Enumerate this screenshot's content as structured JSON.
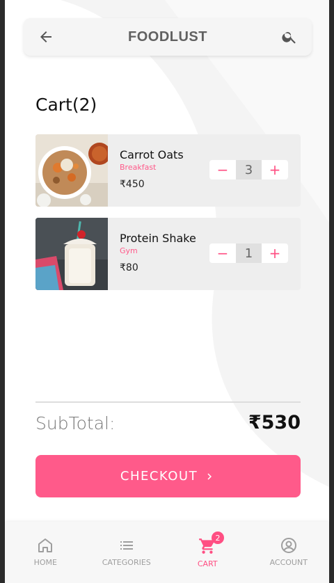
{
  "app": {
    "title": "FOODLUST",
    "accent_color": "#ff5a8a",
    "back_icon": "arrow-left-icon",
    "search_icon": "search-icon"
  },
  "cart": {
    "heading": "Cart(2)",
    "items": [
      {
        "name": "Carrot Oats",
        "category": "Breakfast",
        "price": "₹450",
        "quantity": "3",
        "image": "carrot-oats-photo"
      },
      {
        "name": "Protein Shake",
        "category": "Gym",
        "price": "₹80",
        "quantity": "1",
        "image": "protein-shake-photo"
      }
    ],
    "decrement_symbol": "−",
    "increment_symbol": "+"
  },
  "summary": {
    "subtotal_label": "SubTotal:",
    "subtotal_value": "₹530"
  },
  "checkout": {
    "label": "CHECKOUT",
    "icon": "chevron-right-icon"
  },
  "bottom_nav": {
    "items": [
      {
        "label": "HOME",
        "icon": "home-icon",
        "active": false
      },
      {
        "label": "CATEGORIES",
        "icon": "list-icon",
        "active": false
      },
      {
        "label": "CART",
        "icon": "cart-icon",
        "active": true,
        "badge": "2"
      },
      {
        "label": "ACCOUNT",
        "icon": "account-icon",
        "active": false
      }
    ]
  }
}
